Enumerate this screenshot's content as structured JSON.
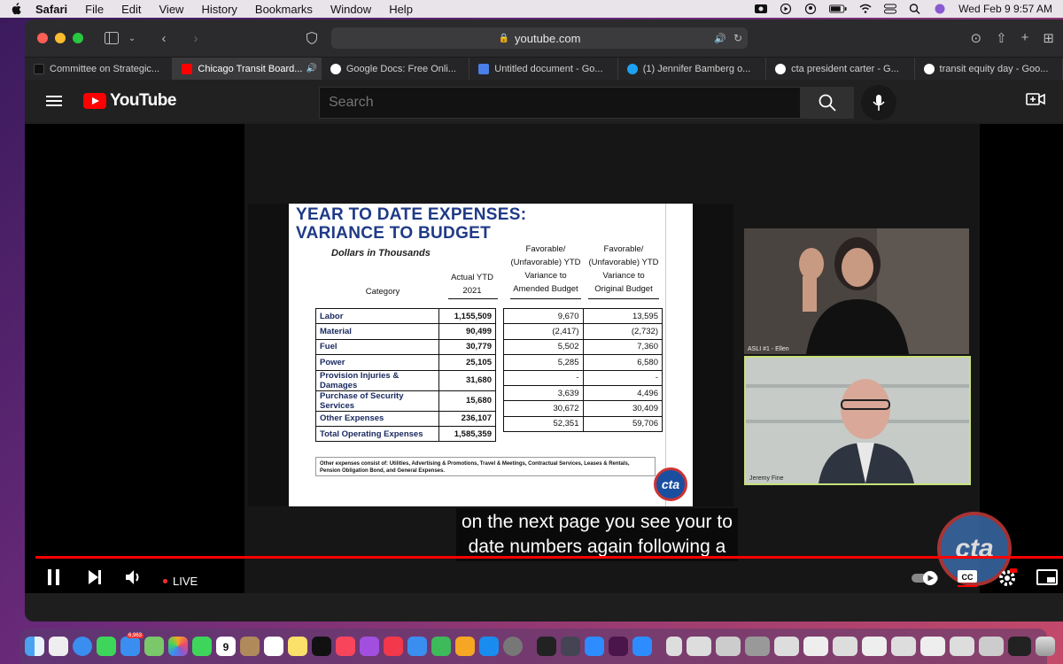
{
  "menubar": {
    "app": "Safari",
    "items": [
      "File",
      "Edit",
      "View",
      "History",
      "Bookmarks",
      "Window",
      "Help"
    ],
    "clock": "Wed Feb 9  9:57 AM"
  },
  "browser": {
    "url": "youtube.com",
    "tabs": [
      {
        "label": "Committee on Strategic...",
        "color": "#111111"
      },
      {
        "label": "Chicago Transit Board...",
        "color": "#ff0000"
      },
      {
        "label": "Google Docs: Free Onli...",
        "color": "#4285f4"
      },
      {
        "label": "Untitled document - Go...",
        "color": "#4a7ee8"
      },
      {
        "label": "(1) Jennifer Bamberg o...",
        "color": "#1da1f2"
      },
      {
        "label": "cta president carter - G...",
        "color": "#4285f4"
      },
      {
        "label": "transit equity day - Goo...",
        "color": "#4285f4"
      }
    ]
  },
  "youtube": {
    "logo_text": "YouTube",
    "search_placeholder": "Search"
  },
  "slide": {
    "title_line1": "YEAR TO DATE EXPENSES:",
    "title_line2": "VARIANCE TO BUDGET",
    "subtitle": "Dollars in Thousands",
    "headers": {
      "category": "Category",
      "actual": [
        "Actual YTD",
        "2021"
      ],
      "amended": [
        "Favorable/",
        "(Unfavorable) YTD",
        "Variance to",
        "Amended Budget"
      ],
      "original": [
        "Favorable/",
        "(Unfavorable) YTD",
        "Variance to",
        "Original Budget"
      ]
    },
    "rows": [
      {
        "category": "Labor",
        "actual": "1,155,509",
        "amended": "9,670",
        "original": "13,595"
      },
      {
        "category": "Material",
        "actual": "90,499",
        "amended": "(2,417)",
        "original": "(2,732)"
      },
      {
        "category": "Fuel",
        "actual": "30,779",
        "amended": "5,502",
        "original": "7,360"
      },
      {
        "category": "Power",
        "actual": "25,105",
        "amended": "5,285",
        "original": "6,580"
      },
      {
        "category": "Provision Injuries & Damages",
        "actual": "31,680",
        "amended": "-",
        "original": "-"
      },
      {
        "category": "Purchase of Security Services",
        "actual": "15,680",
        "amended": "3,639",
        "original": "4,496"
      },
      {
        "category": "Other Expenses",
        "actual": "236,107",
        "amended": "30,672",
        "original": "30,409"
      },
      {
        "category": "Total Operating Expenses",
        "actual": "1,585,359",
        "amended": "52,351",
        "original": "59,706"
      }
    ],
    "footnote": "Other expenses consist of: Utilities, Advertising & Promotions, Travel & Meetings, Contractual Services, Leases & Rentals, Pension Obligation Bond, and General Expenses.",
    "logo_text": "cta"
  },
  "participants": {
    "top_label": "ASLI #1 - Ellen",
    "bottom_label": "Jeremy Fine"
  },
  "captions": {
    "line1": "on the next page you see your to",
    "line2": "date numbers again following a"
  },
  "player": {
    "live_label": "LIVE",
    "watermark": "cta"
  },
  "dock": {
    "mail_badge": "6,963",
    "calendar_day": "9",
    "icons": [
      "finder",
      "launchpad",
      "safari",
      "messages",
      "mail",
      "maps",
      "photos",
      "facetime",
      "calendar",
      "contacts",
      "reminders",
      "notes",
      "tv",
      "music",
      "podcasts",
      "news",
      "keynote",
      "numbers",
      "pages",
      "app-store",
      "system-preferences",
      "zoom",
      "slack",
      "trash"
    ]
  }
}
